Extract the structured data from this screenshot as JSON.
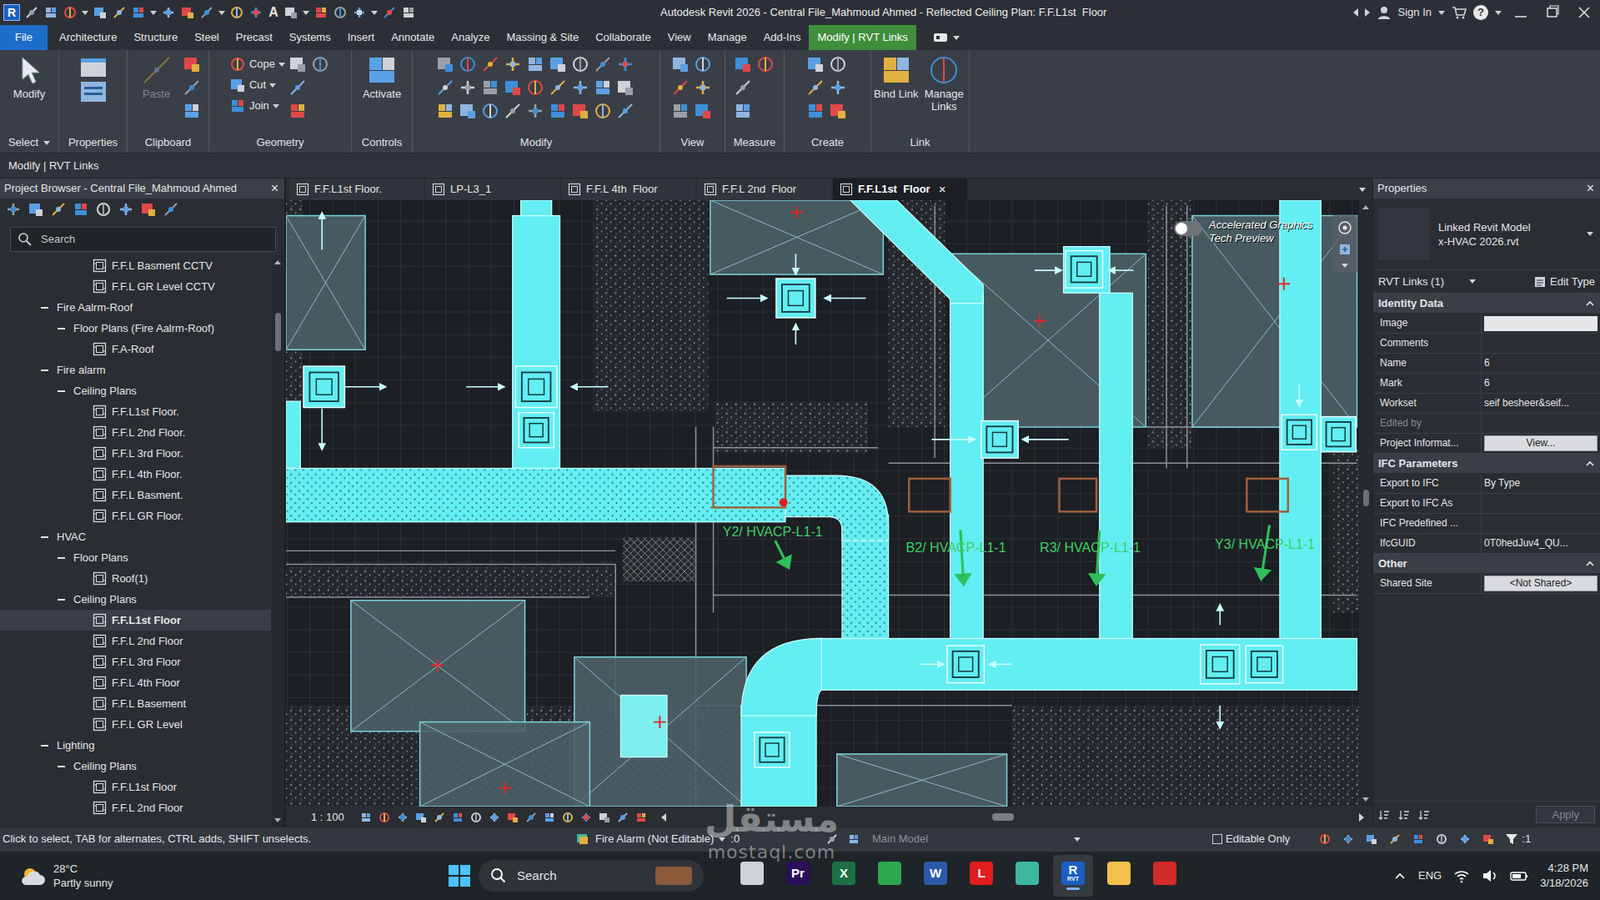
{
  "window": {
    "logo": "R",
    "text_tool": "A",
    "title": "Autodesk Revit 2026 - Central File_Mahmoud Ahmed - Reflected Ceiling Plan: F.F.L1st  Floor",
    "sign_in": "Sign In",
    "help": "?"
  },
  "ribbon_tabs": [
    {
      "label": "File",
      "kind": "file",
      "selected": false
    },
    {
      "label": "Architecture",
      "kind": "normal",
      "selected": false
    },
    {
      "label": "Structure",
      "kind": "normal",
      "selected": false
    },
    {
      "label": "Steel",
      "kind": "normal",
      "selected": false
    },
    {
      "label": "Precast",
      "kind": "normal",
      "selected": false
    },
    {
      "label": "Systems",
      "kind": "normal",
      "selected": false
    },
    {
      "label": "Insert",
      "kind": "normal",
      "selected": false
    },
    {
      "label": "Annotate",
      "kind": "normal",
      "selected": false
    },
    {
      "label": "Analyze",
      "kind": "normal",
      "selected": false
    },
    {
      "label": "Massing & Site",
      "kind": "normal",
      "selected": false
    },
    {
      "label": "Collaborate",
      "kind": "normal",
      "selected": false
    },
    {
      "label": "View",
      "kind": "normal",
      "selected": false
    },
    {
      "label": "Manage",
      "kind": "normal",
      "selected": false
    },
    {
      "label": "Add-Ins",
      "kind": "normal",
      "selected": false
    },
    {
      "label": "Modify | RVT Links",
      "kind": "context",
      "selected": true
    }
  ],
  "ribbon_panels": [
    {
      "label": "Select",
      "menu": true,
      "buttons": [
        {
          "label": "Modify",
          "kind": "large",
          "disabled": false
        }
      ]
    },
    {
      "label": "Properties",
      "menu": false,
      "buttons": []
    },
    {
      "label": "Clipboard",
      "menu": false,
      "buttons": [
        {
          "label": "Paste",
          "kind": "large",
          "disabled": true
        }
      ]
    },
    {
      "label": "Geometry",
      "menu": false,
      "buttons": [
        {
          "label": "Cope",
          "kind": "small",
          "disabled": false
        },
        {
          "label": "Cut",
          "kind": "small",
          "disabled": false
        },
        {
          "label": "Join",
          "kind": "small",
          "disabled": false
        }
      ]
    },
    {
      "label": "Controls",
      "menu": false,
      "buttons": [
        {
          "label": "Activate",
          "kind": "large",
          "disabled": false
        }
      ]
    },
    {
      "label": "Modify",
      "menu": false,
      "buttons": []
    },
    {
      "label": "View",
      "menu": false,
      "buttons": []
    },
    {
      "label": "Measure",
      "menu": false,
      "buttons": []
    },
    {
      "label": "Create",
      "menu": false,
      "buttons": []
    },
    {
      "label": "Link",
      "menu": false,
      "buttons": [
        {
          "label": "Bind Link",
          "kind": "large",
          "disabled": false
        },
        {
          "label": "Manage Links",
          "kind": "large",
          "disabled": false
        }
      ]
    }
  ],
  "context_bar": "Modify | RVT Links",
  "project_browser": {
    "title": "Project Browser - Central File_Mahmoud Ahmed",
    "close": "×",
    "search_placeholder": "Search",
    "items": [
      {
        "label": "F.F.L Basment CCTV",
        "kind": "view",
        "depth": 3,
        "selected": false
      },
      {
        "label": "F.F.L GR Level CCTV",
        "kind": "view",
        "depth": 3,
        "selected": false
      },
      {
        "label": "Fire Aalrm-Roof",
        "kind": "node",
        "depth": 1,
        "expanded": true,
        "selected": false
      },
      {
        "label": "Floor Plans (Fire Aalrm-Roof)",
        "kind": "node",
        "depth": 2,
        "expanded": true,
        "selected": false
      },
      {
        "label": "F.A-Roof",
        "kind": "view",
        "depth": 3,
        "selected": false
      },
      {
        "label": "Fire alarm",
        "kind": "node",
        "depth": 1,
        "expanded": true,
        "selected": false
      },
      {
        "label": "Ceiling Plans",
        "kind": "node",
        "depth": 2,
        "expanded": true,
        "selected": false
      },
      {
        "label": "F.F.L1st Floor.",
        "kind": "view",
        "depth": 3,
        "selected": false
      },
      {
        "label": "F.F.L 2nd Floor.",
        "kind": "view",
        "depth": 3,
        "selected": false
      },
      {
        "label": "F.F.L 3rd Floor.",
        "kind": "view",
        "depth": 3,
        "selected": false
      },
      {
        "label": "F.F.L 4th Floor.",
        "kind": "view",
        "depth": 3,
        "selected": false
      },
      {
        "label": "F.F.L Basment.",
        "kind": "view",
        "depth": 3,
        "selected": false
      },
      {
        "label": "F.F.L GR Floor.",
        "kind": "view",
        "depth": 3,
        "selected": false
      },
      {
        "label": "HVAC",
        "kind": "node",
        "depth": 1,
        "expanded": true,
        "selected": false
      },
      {
        "label": "Floor Plans",
        "kind": "node",
        "depth": 2,
        "expanded": true,
        "selected": false
      },
      {
        "label": "Roof(1)",
        "kind": "view",
        "depth": 3,
        "selected": false
      },
      {
        "label": "Ceiling Plans",
        "kind": "node",
        "depth": 2,
        "expanded": true,
        "selected": false
      },
      {
        "label": "F.F.L1st Floor",
        "kind": "view",
        "depth": 3,
        "selected": true
      },
      {
        "label": "F.F.L 2nd Floor",
        "kind": "view",
        "depth": 3,
        "selected": false
      },
      {
        "label": "F.F.L 3rd Floor",
        "kind": "view",
        "depth": 3,
        "selected": false
      },
      {
        "label": "F.F.L 4th Floor",
        "kind": "view",
        "depth": 3,
        "selected": false
      },
      {
        "label": "F.F.L Basement",
        "kind": "view",
        "depth": 3,
        "selected": false
      },
      {
        "label": "F.F.L GR Level",
        "kind": "view",
        "depth": 3,
        "selected": false
      },
      {
        "label": "Lighting",
        "kind": "node",
        "depth": 1,
        "expanded": true,
        "selected": false
      },
      {
        "label": "Ceiling Plans",
        "kind": "node",
        "depth": 2,
        "expanded": true,
        "selected": false
      },
      {
        "label": "F.F.L1st Floor",
        "kind": "view",
        "depth": 3,
        "selected": false
      },
      {
        "label": "F.F.L 2nd Floor",
        "kind": "view",
        "depth": 3,
        "selected": false
      }
    ]
  },
  "view_tabs": [
    {
      "label": "F.F.L1st Floor.",
      "selected": false
    },
    {
      "label": "LP-L3_1",
      "selected": false
    },
    {
      "label": "F.F.L 4th  Floor",
      "selected": false
    },
    {
      "label": "F.F.L 2nd  Floor",
      "selected": false
    },
    {
      "label": "F.F.L1st  Floor",
      "selected": true,
      "close": "×"
    }
  ],
  "canvas": {
    "tags": [
      {
        "label": "Y2/ HVACP-L1-1"
      },
      {
        "label": "B2/ HVACP-L1-1"
      },
      {
        "label": "R3/ HVACP-L1-1"
      },
      {
        "label": "Y3/ HVACP-L1-1"
      }
    ],
    "preview_toggle": {
      "label": "Accelerated Graphics Tech Preview",
      "on": false
    },
    "scale": "1 : 100"
  },
  "properties": {
    "title": "Properties",
    "close": "×",
    "family": "Linked Revit Model",
    "type": "x-HVAC 2026.rvt",
    "selector": "RVT Links (1)",
    "edit_type": "Edit Type",
    "groups": [
      {
        "label": "Identity Data",
        "expanded": true,
        "rows": [
          {
            "label": "Image",
            "value": "",
            "kind": "box",
            "disabled": false
          },
          {
            "label": "Comments",
            "value": "",
            "kind": "text",
            "disabled": false
          },
          {
            "label": "Name",
            "value": "6",
            "kind": "text",
            "disabled": false
          },
          {
            "label": "Mark",
            "value": "6",
            "kind": "text",
            "disabled": false
          },
          {
            "label": "Workset",
            "value": "seif besheer&seif...",
            "kind": "text",
            "disabled": false
          },
          {
            "label": "Edited by",
            "value": "",
            "kind": "text",
            "disabled": true
          },
          {
            "label": "Project Informat...",
            "value": "View...",
            "kind": "button",
            "disabled": false
          }
        ]
      },
      {
        "label": "IFC Parameters",
        "expanded": true,
        "rows": [
          {
            "label": "Export to IFC",
            "value": "By Type",
            "kind": "text",
            "disabled": false
          },
          {
            "label": "Export to IFC As",
            "value": "",
            "kind": "text",
            "disabled": false
          },
          {
            "label": "IFC Predefined ...",
            "value": "",
            "kind": "text",
            "disabled": false
          },
          {
            "label": "IfcGUID",
            "value": "0T0hedJuv4_QU...",
            "kind": "text",
            "disabled": false
          }
        ]
      },
      {
        "label": "Other",
        "expanded": true,
        "rows": [
          {
            "label": "Shared Site",
            "value": "<Not Shared>",
            "kind": "button",
            "disabled": false
          }
        ]
      }
    ],
    "apply": {
      "label": "Apply",
      "disabled": true
    }
  },
  "status_bar": {
    "hint": "Click to select, TAB for alternates, CTRL adds, SHIFT unselects.",
    "workset": "Fire Alarm (Not Editable)",
    "workset_count": ":0",
    "design_option": "Main Model",
    "editable_only": {
      "label": "Editable Only",
      "checked": false
    },
    "filter_count": ":1"
  },
  "taskbar": {
    "weather": {
      "temp": "28°C",
      "desc": "Partly sunny"
    },
    "search": "Search",
    "apps": [
      {
        "color": "#cfd2d6",
        "active": false
      },
      {
        "glyph": "Pr",
        "color": "#2b0f5a",
        "active": false
      },
      {
        "glyph": "X",
        "color": "#1d7044",
        "active": false
      },
      {
        "color": "#2ea84e",
        "active": false
      },
      {
        "glyph": "W",
        "color": "#2b5aa8",
        "active": false
      },
      {
        "glyph": "L",
        "color": "#e11d1d",
        "active": false
      },
      {
        "color": "#3fb6a0",
        "active": false
      },
      {
        "glyph": "R",
        "sub": "RVT",
        "color": "#1b5fc0",
        "active": true
      },
      {
        "color": "#f2c14b",
        "active": false
      },
      {
        "color": "#d32a2a",
        "active": false
      }
    ],
    "language": "ENG",
    "time": "4:28 PM",
    "date": "3/18/2026"
  },
  "watermark": {
    "word": "مستقل",
    "site": "mostaql.com"
  }
}
